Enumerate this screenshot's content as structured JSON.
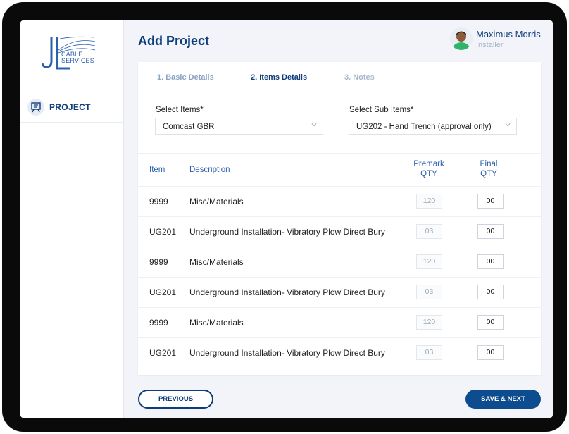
{
  "brand": {
    "logo_text": "CABLE\nSERVICES"
  },
  "sidebar": {
    "items": [
      {
        "label": "PROJECT",
        "icon": "presentation-board-icon"
      }
    ]
  },
  "header": {
    "title": "Add Project"
  },
  "user": {
    "name": "Maximus Morris",
    "role": "Installer"
  },
  "steps": [
    {
      "label": "1. Basic Details",
      "state": "completed"
    },
    {
      "label": "2. Items Details",
      "state": "active"
    },
    {
      "label": "3. Notes",
      "state": "upcoming"
    }
  ],
  "form": {
    "items": {
      "label": "Select Items*",
      "value": "Comcast GBR"
    },
    "sub_items": {
      "label": "Select Sub Items*",
      "value": "UG202 - Hand Trench (approval only)"
    }
  },
  "table": {
    "headers": {
      "item": "Item",
      "description": "Description",
      "premark_1": "Premark",
      "premark_2": "QTY",
      "final_1": "Final",
      "final_2": "QTY"
    },
    "rows": [
      {
        "item": "9999",
        "description": "Misc/Materials",
        "premark": "120",
        "final": "00"
      },
      {
        "item": "UG201",
        "description": "Underground Installation- Vibratory Plow Direct Bury",
        "premark": "03",
        "final": "00"
      },
      {
        "item": "9999",
        "description": "Misc/Materials",
        "premark": "120",
        "final": "00"
      },
      {
        "item": "UG201",
        "description": "Underground Installation- Vibratory Plow Direct Bury",
        "premark": "03",
        "final": "00"
      },
      {
        "item": "9999",
        "description": "Misc/Materials",
        "premark": "120",
        "final": "00"
      },
      {
        "item": "UG201",
        "description": "Underground Installation- Vibratory Plow Direct Bury",
        "premark": "03",
        "final": "00"
      }
    ]
  },
  "footer": {
    "previous_label": "PREVIOUS",
    "next_label": "SAVE & NEXT"
  },
  "colors": {
    "primary": "#0d3d7a",
    "accent": "#2d5fae",
    "button": "#0d4c8f",
    "background": "#f2f4f9"
  }
}
